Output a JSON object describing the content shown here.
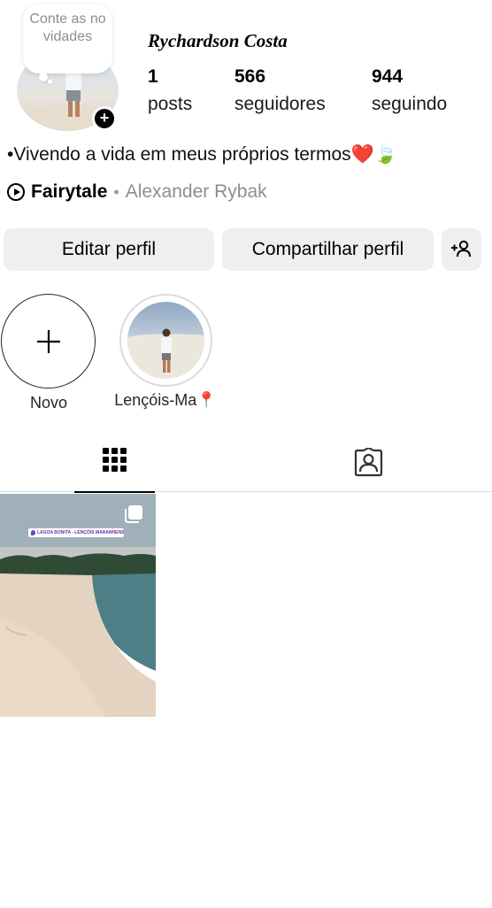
{
  "profile": {
    "username": "Rychardson Costa",
    "note": "Conte as novidades",
    "add_badge": "+"
  },
  "stats": {
    "posts": {
      "value": "1",
      "label": "posts"
    },
    "followers": {
      "value": "566",
      "label": "seguidores"
    },
    "following": {
      "value": "944",
      "label": "seguindo"
    }
  },
  "bio": {
    "text": "•Vivendo a vida em meus próprios termos❤️🍃"
  },
  "music": {
    "song": "Fairytale",
    "separator": "•",
    "artist": "Alexander Rybak"
  },
  "actions": {
    "edit_label": "Editar perfil",
    "share_label": "Compartilhar perfil",
    "discover_icon": "add-person-icon"
  },
  "highlights": [
    {
      "label": "Novo",
      "icon": "plus-icon"
    },
    {
      "label": "Lençóis-Ma📍"
    }
  ],
  "tabs": [
    {
      "icon": "grid-icon",
      "active": true
    },
    {
      "icon": "tagged-person-icon",
      "active": false
    }
  ],
  "posts": [
    {
      "overlay_text": "LAGOA BONITA - LENÇÓIS MARANHENSES",
      "multi": true
    }
  ],
  "colors": {
    "button_bg": "#efefef",
    "secondary_text": "#8e8e8e",
    "divider": "#dbdbdb"
  }
}
